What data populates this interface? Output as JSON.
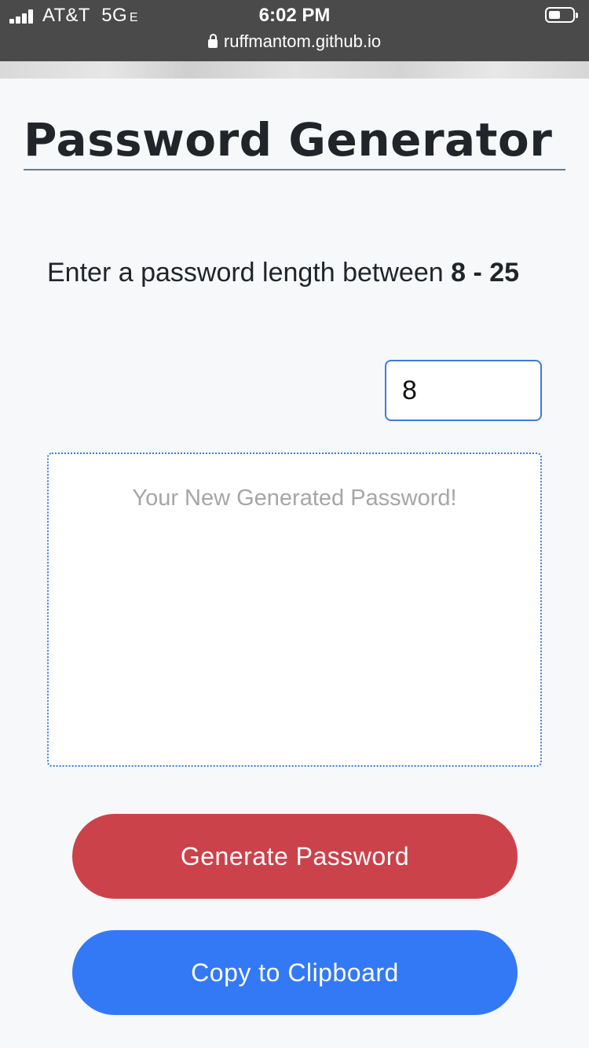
{
  "status_bar": {
    "carrier": "AT&T",
    "network": "5G",
    "network_suffix": "E",
    "time": "6:02 PM",
    "url": "ruffmantom.github.io"
  },
  "page": {
    "title": "Password Generator",
    "prompt_text": "Enter a password length between ",
    "prompt_range": "8 - 25",
    "length_value": "8",
    "output_placeholder": "Your New Generated Password!",
    "generate_label": "Generate Password",
    "copy_label": "Copy to Clipboard"
  },
  "colors": {
    "generate_button": "#cc424a",
    "copy_button": "#3379f5",
    "input_border": "#3e7bd6"
  }
}
